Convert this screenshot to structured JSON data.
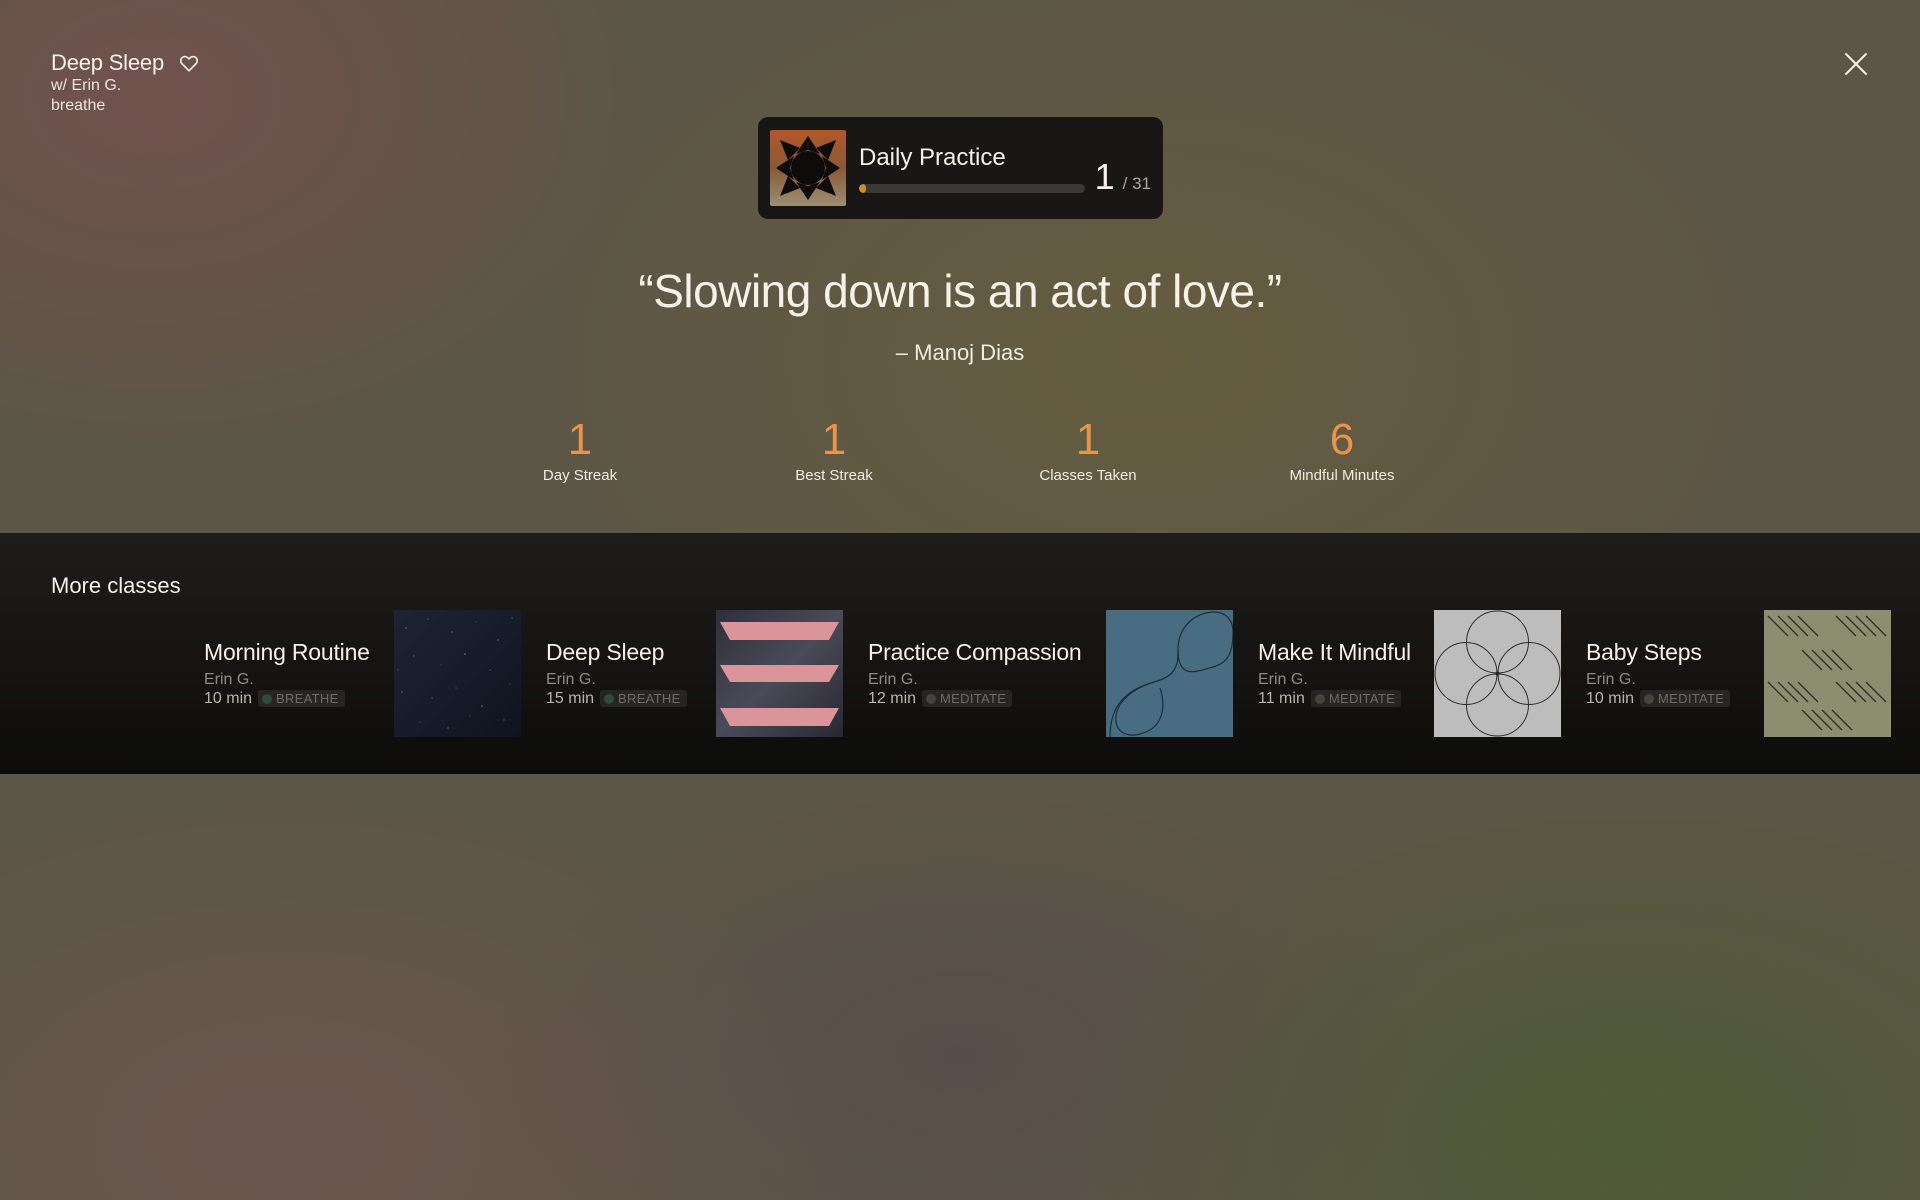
{
  "now_playing": {
    "title": "Deep Sleep",
    "instructor": "w/ Erin G.",
    "category": "breathe"
  },
  "daily_practice": {
    "title": "Daily Practice",
    "current": "1",
    "total": "/ 31",
    "progress_fraction": 0.032,
    "accent_color": "#d38a2e"
  },
  "quote": {
    "text": "“Slowing down is an act of love.”",
    "author": "– Manoj Dias"
  },
  "stats": [
    {
      "value": "1",
      "label": "Day Streak"
    },
    {
      "value": "1",
      "label": "Best Streak"
    },
    {
      "value": "1",
      "label": "Classes Taken"
    },
    {
      "value": "6",
      "label": "Mindful Minutes"
    }
  ],
  "more_classes": {
    "title": "More classes",
    "items": [
      {
        "title": "Morning Routine",
        "instructor": "Erin G.",
        "duration": "10 min",
        "category": "BREATHE",
        "badge_dot_color": "#2f4a3e",
        "thumb": "none"
      },
      {
        "title": "Deep Sleep",
        "instructor": "Erin G.",
        "duration": "15 min",
        "category": "BREATHE",
        "badge_dot_color": "#2f4a3e",
        "thumb": "starfield"
      },
      {
        "title": "Practice Compassion",
        "instructor": "Erin G.",
        "duration": "12 min",
        "category": "MEDITATE",
        "badge_dot_color": "#44443f",
        "thumb": "pink-stripes"
      },
      {
        "title": "Make It Mindful",
        "instructor": "Erin G.",
        "duration": "11 min",
        "category": "MEDITATE",
        "badge_dot_color": "#44443f",
        "thumb": "blue-curves"
      },
      {
        "title": "Baby Steps",
        "instructor": "Erin G.",
        "duration": "10 min",
        "category": "MEDITATE",
        "badge_dot_color": "#44443f",
        "thumb": "grey-circles"
      },
      {
        "title": "",
        "instructor": "",
        "duration": "",
        "category": "",
        "badge_dot_color": "#44443f",
        "thumb": "olive-lines"
      }
    ]
  },
  "colors": {
    "stat_value": "#e8944a",
    "band_background": "#141312"
  }
}
